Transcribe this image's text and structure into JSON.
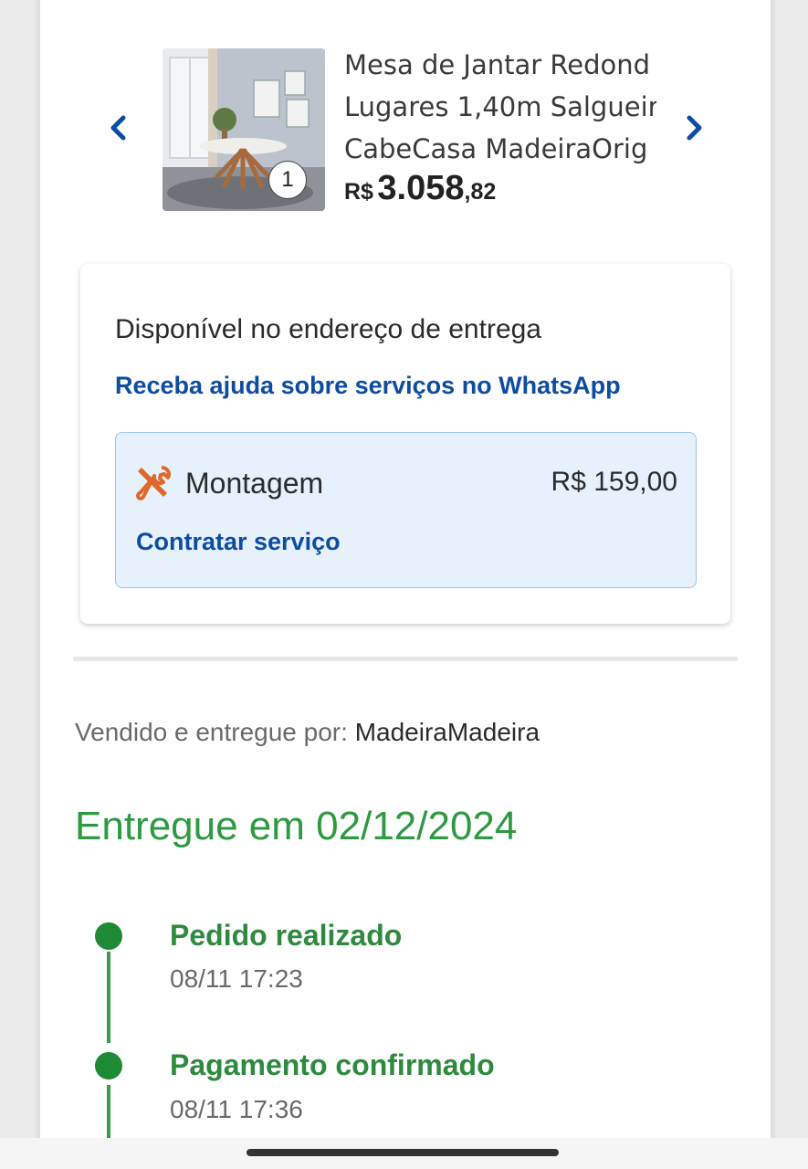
{
  "product": {
    "title_lines": [
      "Mesa de Jantar Redond",
      "Lugares 1,40m Salgueir",
      "CabeCasa MadeiraOrig"
    ],
    "quantity": "1",
    "price_currency": "R$",
    "price_integer": "3.058",
    "price_cents": ",82",
    "image_icon": "dining-table-photo"
  },
  "carousel": {
    "prev_icon": "chevron-left-icon",
    "next_icon": "chevron-right-icon",
    "accent_color": "#0d4da1"
  },
  "service_card": {
    "title": "Disponível no endereço de entrega",
    "help_link": "Receba ajuda sobre serviços no WhatsApp",
    "service": {
      "icon": "tools-icon",
      "name": "Montagem",
      "price": "R$ 159,00",
      "action": "Contratar serviço"
    }
  },
  "seller": {
    "label": "Vendido e entregue por:",
    "name": "MadeiraMadeira"
  },
  "delivery": {
    "status": "Entregue em 02/12/2024",
    "color": "#2e9a42"
  },
  "timeline": [
    {
      "title": "Pedido realizado",
      "time": "08/11 17:23"
    },
    {
      "title": "Pagamento confirmado",
      "time": "08/11 17:36"
    }
  ]
}
